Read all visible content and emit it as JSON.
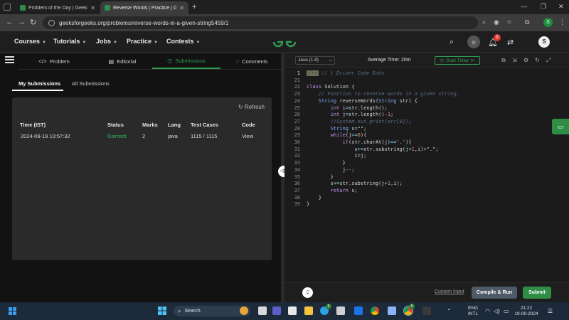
{
  "browser": {
    "tabs": [
      {
        "title": "Problem of the Day | GeeksforG"
      },
      {
        "title": "Reverse Words | Practice | Geek"
      }
    ],
    "url": "geeksforgeeks.org/problems/reverse-words-in-a-given-string5459/1",
    "profile_initial": "S"
  },
  "header": {
    "menu": [
      "Courses",
      "Tutorials",
      "Jobs",
      "Practice",
      "Contests"
    ],
    "notification_count": "9",
    "avatar_initial": "S"
  },
  "problem_tabs": [
    {
      "icon": "</>",
      "label": "Problem"
    },
    {
      "icon": "▤",
      "label": "Editorial"
    },
    {
      "icon": "◷",
      "label": "Submissions"
    },
    {
      "icon": "◌",
      "label": "Comments"
    }
  ],
  "submissions": {
    "tabs": [
      "My Submissions",
      "All Submissions"
    ],
    "refresh_label": "Refresh",
    "columns": [
      "Time (IST)",
      "Status",
      "Marks",
      "Lang",
      "Test Cases",
      "Code"
    ],
    "rows": [
      {
        "time": "2024-09-19 10:57:32",
        "status": "Correct",
        "marks": "2",
        "lang": "java",
        "test_cases": "1115 / 1115",
        "code": "View"
      }
    ]
  },
  "editor": {
    "language": "Java (1.8)",
    "average_time": "Average Time: 20m",
    "timer_label": "Start Timer",
    "custom_input": "Custom Input",
    "run_label": "Compile & Run",
    "submit_label": "Submit",
    "lines": [
      {
        "n": "1",
        "text": "// } Driver Code Ends"
      },
      {
        "n": "21",
        "text": ""
      },
      {
        "n": "22",
        "text": "class Solution {"
      },
      {
        "n": "23",
        "text": "    // Function to reverse words in a given string."
      },
      {
        "n": "24",
        "text": "    String reverseWords(String str) {"
      },
      {
        "n": "25",
        "text": "        int i=str.length();"
      },
      {
        "n": "26",
        "text": "        int j=str.length()-1;"
      },
      {
        "n": "27",
        "text": "        //System.out.print(arr[0]);"
      },
      {
        "n": "28",
        "text": "        String s=\"\";"
      },
      {
        "n": "29",
        "text": "        while(j>=0){"
      },
      {
        "n": "30",
        "text": "            if(str.charAt(j)=='.'){"
      },
      {
        "n": "31",
        "text": "                s+=str.substring(j+1,i)+\".\";"
      },
      {
        "n": "32",
        "text": "                i=j;"
      },
      {
        "n": "33",
        "text": "            }"
      },
      {
        "n": "34",
        "text": "            j--;"
      },
      {
        "n": "35",
        "text": "        }"
      },
      {
        "n": "36",
        "text": "        s+=str.substring(j+1,i);"
      },
      {
        "n": "37",
        "text": "        return s;"
      },
      {
        "n": "38",
        "text": "    }"
      },
      {
        "n": "39",
        "text": "}"
      }
    ]
  },
  "taskbar": {
    "search_placeholder": "Search",
    "chrome_badge": "5",
    "teams_badge": "6",
    "lang_line1": "ENG",
    "lang_line2": "INTL",
    "time": "21:22",
    "date": "19-09-2024"
  },
  "colors": {
    "accent_green": "#2f8d46",
    "correct_green": "#2f9e52",
    "badge_red": "#e53935"
  }
}
